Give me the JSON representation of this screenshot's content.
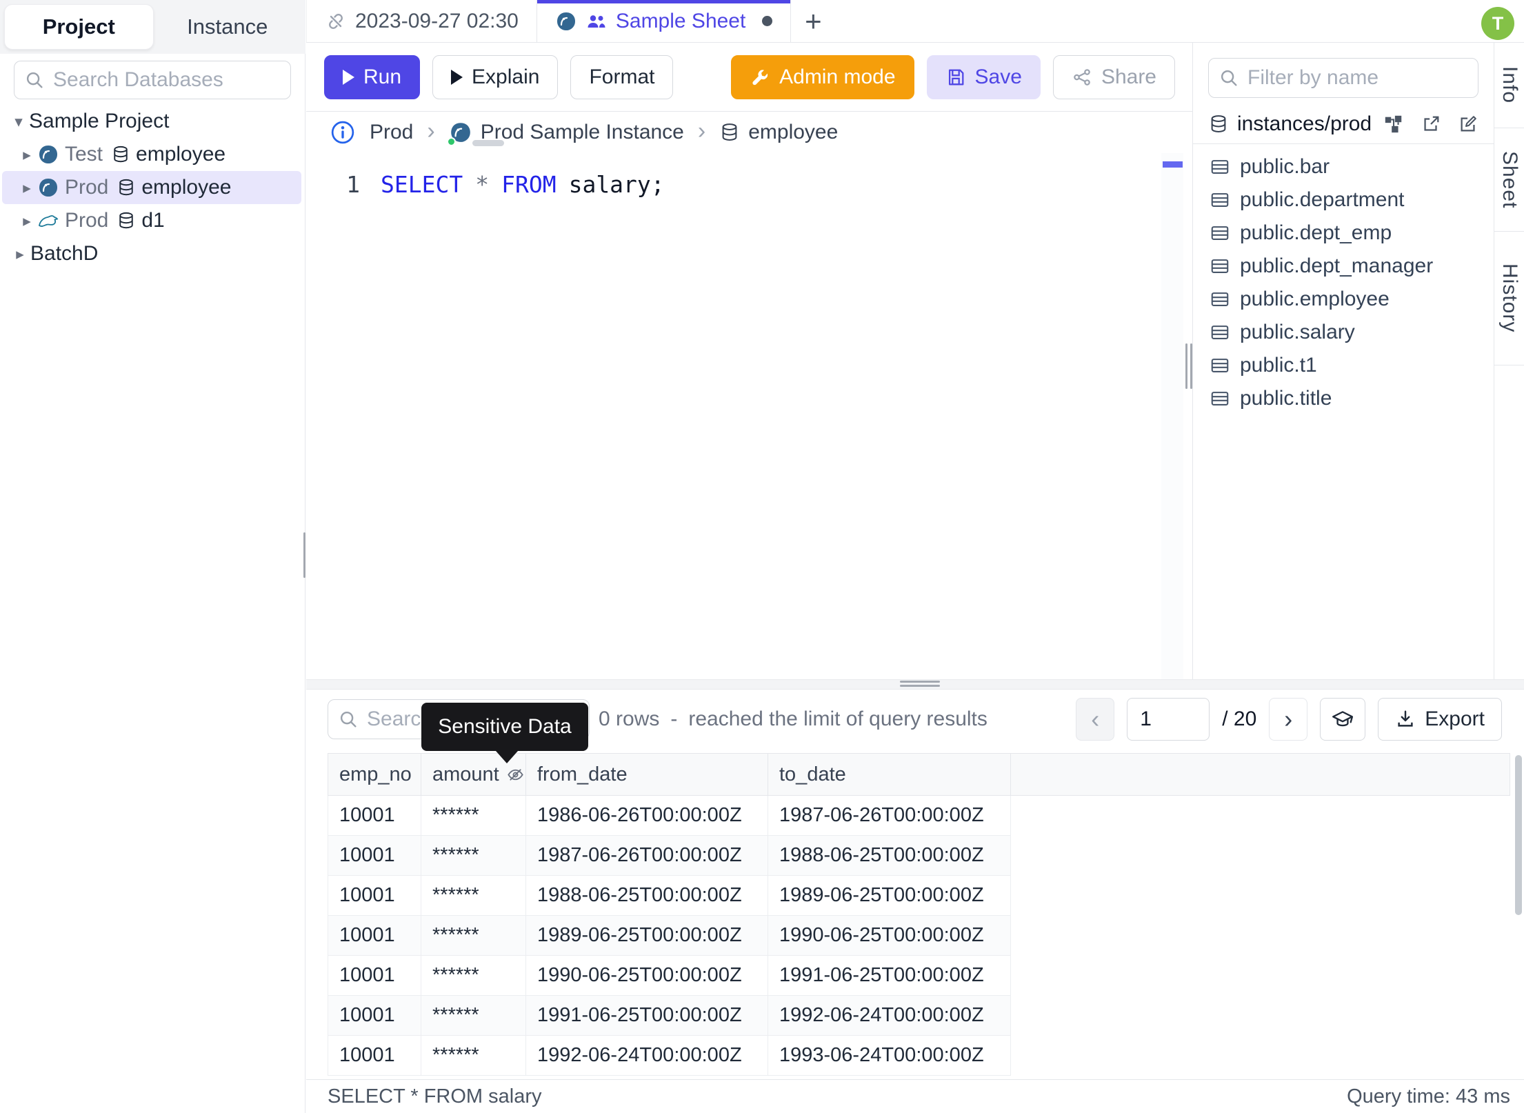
{
  "colors": {
    "accent": "#4f46e5",
    "admin_orange": "#f59e0b",
    "avatar_green": "#84c147",
    "keyword_blue": "#2323e8",
    "postgres_blue": "#336791",
    "mysql_teal": "#00758f",
    "status_green": "#2fc76b"
  },
  "left_sidebar": {
    "tabs": [
      {
        "label": "Project"
      },
      {
        "label": "Instance"
      }
    ],
    "search_placeholder": "Search Databases",
    "tree": {
      "project": {
        "label": "Sample Project"
      },
      "item_test": {
        "env": "Test",
        "database": "employee",
        "engine": "postgresql"
      },
      "item_prod_pg": {
        "env": "Prod",
        "database": "employee",
        "engine": "postgresql",
        "selected": true
      },
      "item_prod_mysql": {
        "env": "Prod",
        "database": "d1",
        "engine": "mysql"
      },
      "batch": {
        "label": "BatchD"
      }
    }
  },
  "tab_bar": {
    "tabs": [
      {
        "title": "2023-09-27 02:30"
      },
      {
        "title": "Sample Sheet",
        "active": true
      }
    ],
    "new_tab_label": "+"
  },
  "toolbar": {
    "run": "Run",
    "explain": "Explain",
    "format": "Format",
    "admin_mode": "Admin mode",
    "save": "Save",
    "share": "Share"
  },
  "breadcrumb": {
    "env": "Prod",
    "instance": "Prod Sample Instance",
    "database": "employee",
    "separator": "›"
  },
  "editor": {
    "line_number": "1",
    "keyword_select": "SELECT",
    "star": "*",
    "keyword_from": "FROM",
    "identifier": "salary;"
  },
  "right_panel": {
    "filter_placeholder": "Filter by name",
    "source": "instances/prod",
    "tables": [
      "public.bar",
      "public.department",
      "public.dept_emp",
      "public.dept_manager",
      "public.employee",
      "public.salary",
      "public.t1",
      "public.title"
    ]
  },
  "side_tabs": {
    "info": "Info",
    "sheet": "Sheet",
    "history": "History"
  },
  "user": {
    "avatar_initial": "T"
  },
  "results": {
    "search_placeholder": "Search",
    "tooltip": "Sensitive Data",
    "rows_count": "0 rows",
    "rows_sep": "-",
    "rows_note": "reached the limit of query results",
    "page_value": "1",
    "page_total": "/ 20",
    "prev_label": "‹",
    "next_label": "›",
    "export_label": "Export",
    "columns": [
      "emp_no",
      "amount",
      "from_date",
      "to_date"
    ],
    "masked_column": "amount",
    "rows": [
      [
        "10001",
        "******",
        "1986-06-26T00:00:00Z",
        "1987-06-26T00:00:00Z"
      ],
      [
        "10001",
        "******",
        "1987-06-26T00:00:00Z",
        "1988-06-25T00:00:00Z"
      ],
      [
        "10001",
        "******",
        "1988-06-25T00:00:00Z",
        "1989-06-25T00:00:00Z"
      ],
      [
        "10001",
        "******",
        "1989-06-25T00:00:00Z",
        "1990-06-25T00:00:00Z"
      ],
      [
        "10001",
        "******",
        "1990-06-25T00:00:00Z",
        "1991-06-25T00:00:00Z"
      ],
      [
        "10001",
        "******",
        "1991-06-25T00:00:00Z",
        "1992-06-24T00:00:00Z"
      ],
      [
        "10001",
        "******",
        "1992-06-24T00:00:00Z",
        "1993-06-24T00:00:00Z"
      ]
    ]
  },
  "status_bar": {
    "statement": "SELECT * FROM salary",
    "query_time": "Query time: 43 ms"
  }
}
